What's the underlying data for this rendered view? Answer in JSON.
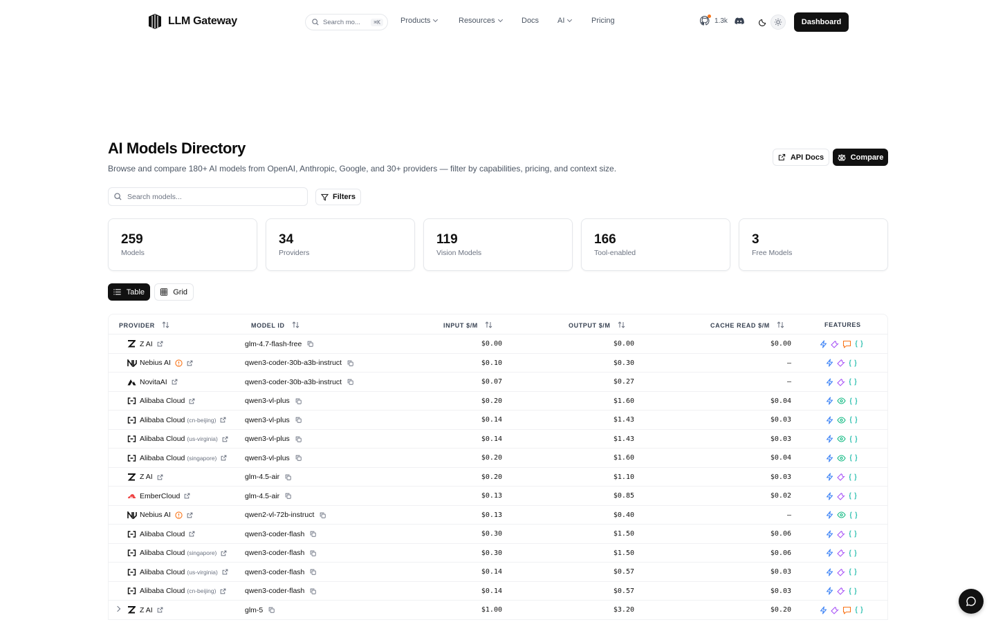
{
  "header": {
    "brand": "LLM Gateway",
    "search_placeholder": "Search mo...",
    "search_kbd": "⌘K",
    "nav": [
      {
        "label": "Products",
        "dropdown": true
      },
      {
        "label": "Resources",
        "dropdown": true
      },
      {
        "label": "Docs",
        "dropdown": false
      },
      {
        "label": "AI",
        "dropdown": true
      },
      {
        "label": "Pricing",
        "dropdown": false
      }
    ],
    "github_stars": "1.3k",
    "dashboard_label": "Dashboard"
  },
  "page": {
    "title": "AI Models Directory",
    "subtitle": "Browse and compare 180+ AI models from OpenAI, Anthropic, Google, and 30+ providers — filter by capabilities, pricing, and context size.",
    "api_docs_label": "API Docs",
    "compare_label": "Compare",
    "search_placeholder": "Search models...",
    "filters_label": "Filters"
  },
  "stats": [
    {
      "value": "259",
      "label": "Models"
    },
    {
      "value": "34",
      "label": "Providers"
    },
    {
      "value": "119",
      "label": "Vision Models"
    },
    {
      "value": "166",
      "label": "Tool-enabled"
    },
    {
      "value": "3",
      "label": "Free Models"
    }
  ],
  "view_toggle": {
    "table_label": "Table",
    "grid_label": "Grid",
    "active": "table"
  },
  "table": {
    "columns": {
      "provider": "PROVIDER",
      "model_id": "MODEL ID",
      "input": "INPUT $/M",
      "output": "OUTPUT $/M",
      "cache_read": "CACHE READ $/M",
      "features": "FEATURES"
    },
    "rows": [
      {
        "provider": "Z AI",
        "region": "",
        "logo": "zai-logo",
        "warning": false,
        "model_id": "glm-4.7-flash-free",
        "input": "$0.00",
        "output": "$0.00",
        "cache_read": "$0.00",
        "features": [
          "streaming",
          "tools",
          "reasoning",
          "json"
        ],
        "expandable": false
      },
      {
        "provider": "Nebius AI",
        "region": "",
        "logo": "nebius-logo",
        "warning": true,
        "model_id": "qwen3-coder-30b-a3b-instruct",
        "input": "$0.10",
        "output": "$0.30",
        "cache_read": "–",
        "features": [
          "streaming",
          "tools",
          "json"
        ],
        "expandable": false
      },
      {
        "provider": "NovitaAI",
        "region": "",
        "logo": "novita-logo",
        "warning": false,
        "model_id": "qwen3-coder-30b-a3b-instruct",
        "input": "$0.07",
        "output": "$0.27",
        "cache_read": "–",
        "features": [
          "streaming",
          "tools",
          "json"
        ],
        "expandable": false
      },
      {
        "provider": "Alibaba Cloud",
        "region": "",
        "logo": "alibaba-logo",
        "warning": false,
        "model_id": "qwen3-vl-plus",
        "input": "$0.20",
        "output": "$1.60",
        "cache_read": "$0.04",
        "features": [
          "streaming",
          "vision",
          "json"
        ],
        "expandable": false
      },
      {
        "provider": "Alibaba Cloud",
        "region": "(cn-beijing)",
        "logo": "alibaba-logo",
        "warning": false,
        "model_id": "qwen3-vl-plus",
        "input": "$0.14",
        "output": "$1.43",
        "cache_read": "$0.03",
        "features": [
          "streaming",
          "vision",
          "json"
        ],
        "expandable": false
      },
      {
        "provider": "Alibaba Cloud",
        "region": "(us-virginia)",
        "logo": "alibaba-logo",
        "warning": false,
        "model_id": "qwen3-vl-plus",
        "input": "$0.14",
        "output": "$1.43",
        "cache_read": "$0.03",
        "features": [
          "streaming",
          "vision",
          "json"
        ],
        "expandable": false
      },
      {
        "provider": "Alibaba Cloud",
        "region": "(singapore)",
        "logo": "alibaba-logo",
        "warning": false,
        "model_id": "qwen3-vl-plus",
        "input": "$0.20",
        "output": "$1.60",
        "cache_read": "$0.04",
        "features": [
          "streaming",
          "vision",
          "json"
        ],
        "expandable": false
      },
      {
        "provider": "Z AI",
        "region": "",
        "logo": "zai-logo",
        "warning": false,
        "model_id": "glm-4.5-air",
        "input": "$0.20",
        "output": "$1.10",
        "cache_read": "$0.03",
        "features": [
          "streaming",
          "tools",
          "json"
        ],
        "expandable": false
      },
      {
        "provider": "EmberCloud",
        "region": "",
        "logo": "embercloud-logo",
        "warning": false,
        "model_id": "glm-4.5-air",
        "input": "$0.13",
        "output": "$0.85",
        "cache_read": "$0.02",
        "features": [
          "streaming",
          "tools",
          "json"
        ],
        "expandable": false
      },
      {
        "provider": "Nebius AI",
        "region": "",
        "logo": "nebius-logo",
        "warning": true,
        "model_id": "qwen2-vl-72b-instruct",
        "input": "$0.13",
        "output": "$0.40",
        "cache_read": "–",
        "features": [
          "streaming",
          "vision",
          "json"
        ],
        "expandable": false
      },
      {
        "provider": "Alibaba Cloud",
        "region": "",
        "logo": "alibaba-logo",
        "warning": false,
        "model_id": "qwen3-coder-flash",
        "input": "$0.30",
        "output": "$1.50",
        "cache_read": "$0.06",
        "features": [
          "streaming",
          "tools",
          "json"
        ],
        "expandable": false
      },
      {
        "provider": "Alibaba Cloud",
        "region": "(singapore)",
        "logo": "alibaba-logo",
        "warning": false,
        "model_id": "qwen3-coder-flash",
        "input": "$0.30",
        "output": "$1.50",
        "cache_read": "$0.06",
        "features": [
          "streaming",
          "tools",
          "json"
        ],
        "expandable": false
      },
      {
        "provider": "Alibaba Cloud",
        "region": "(us-virginia)",
        "logo": "alibaba-logo",
        "warning": false,
        "model_id": "qwen3-coder-flash",
        "input": "$0.14",
        "output": "$0.57",
        "cache_read": "$0.03",
        "features": [
          "streaming",
          "tools",
          "json"
        ],
        "expandable": false
      },
      {
        "provider": "Alibaba Cloud",
        "region": "(cn-beijing)",
        "logo": "alibaba-logo",
        "warning": false,
        "model_id": "qwen3-coder-flash",
        "input": "$0.14",
        "output": "$0.57",
        "cache_read": "$0.03",
        "features": [
          "streaming",
          "tools",
          "json"
        ],
        "expandable": false
      },
      {
        "provider": "Z AI",
        "region": "",
        "logo": "zai-logo",
        "warning": false,
        "model_id": "glm-5",
        "input": "$1.00",
        "output": "$3.20",
        "cache_read": "$0.20",
        "features": [
          "streaming",
          "tools",
          "reasoning",
          "json"
        ],
        "expandable": true
      }
    ]
  },
  "colors": {
    "primary": "#111111",
    "streaming_icon": "#3b82f6",
    "tools_icon": "#a855f7",
    "vision_icon": "#10b981",
    "reasoning_icon": "#f97316",
    "json_icon": "#14b8a6",
    "warning": "#f97316"
  }
}
